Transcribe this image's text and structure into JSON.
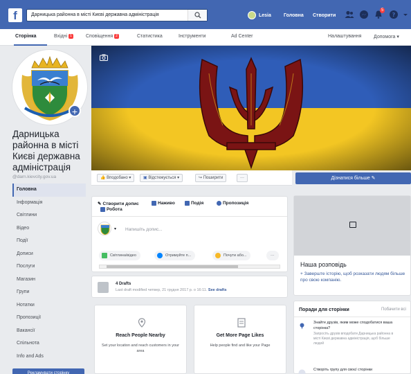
{
  "topbar": {
    "logo": "f",
    "search_value": "Дарницька районна в місті Києві державна адміністрація",
    "user_name": "Lesia",
    "home_label": "Головна",
    "create_label": "Створити",
    "notifications_count": "5"
  },
  "page_tabs": {
    "items": [
      {
        "label": "Сторінка",
        "badge": ""
      },
      {
        "label": "Вхідні",
        "badge": "1"
      },
      {
        "label": "Сповіщення",
        "badge": "2"
      },
      {
        "label": "Статистика",
        "badge": ""
      },
      {
        "label": "Інструменти",
        "badge": ""
      },
      {
        "label": "Ad Center",
        "badge": ""
      }
    ],
    "settings_label": "Налаштування",
    "help_label": "Допомога ▾"
  },
  "page": {
    "name": "Дарницька районна в місті Києві державна адміністрація",
    "handle": "@darn.kievcity.gov.ua"
  },
  "left_nav": {
    "items": [
      "Головна",
      "Інформація",
      "Світлини",
      "Відео",
      "Події",
      "Дописи",
      "Послуги",
      "Магазин",
      "Групи",
      "Нотатки",
      "Пропозиції",
      "Вакансії",
      "Спільнота",
      "Info and Ads"
    ],
    "promote_label": "Рекламувати сторінку"
  },
  "actions": {
    "liked": "Вподобано ▾",
    "following": "Відстежується ▾",
    "share": "Поширити",
    "more": "···",
    "learn_more": "Дізнатися більше ✎"
  },
  "composer": {
    "tabs": [
      "Створити допис",
      "Наживо",
      "Подія",
      "Пропозиція"
    ],
    "tab_sub": "Робота",
    "placeholder": "Напишіть допис...",
    "chips": [
      "Світлина/відео",
      "Отримуйте п...",
      "Почути або..."
    ],
    "more": "···"
  },
  "drafts": {
    "title": "4 Drafts",
    "meta": "Last draft modified четвер, 21 грудня 2017 р. о 16:11.",
    "link": "See drafts"
  },
  "promos": [
    {
      "title": "Reach People Nearby",
      "desc": "Set your location and reach customers in your area",
      "icon": "location-icon"
    },
    {
      "title": "Get More Page Likes",
      "desc": "Help people find and like your Page",
      "icon": "page-icon"
    }
  ],
  "story": {
    "title": "Наша розповідь",
    "text": "+ Заверште історію, щоб розказати людям більше про свою компанію."
  },
  "tips": {
    "heading": "Поради для сторінки",
    "see_all": "Побачити всі",
    "items": [
      {
        "title": "Знайте друзів, яким може сподобатися ваша сторінка?",
        "desc": "Запросіть друзів вподобати Дарницька районна в місті Києві державна адміністрація, щоб більше людей"
      },
      {
        "title": "Створіть групу для своєї сторінки",
        "desc": ""
      }
    ]
  },
  "colors": {
    "brand": "#4267b2",
    "background": "#e9ebee",
    "badge": "#fa3e3e",
    "flag_blue": "#2f5db8",
    "flag_yellow": "#f3c623"
  }
}
